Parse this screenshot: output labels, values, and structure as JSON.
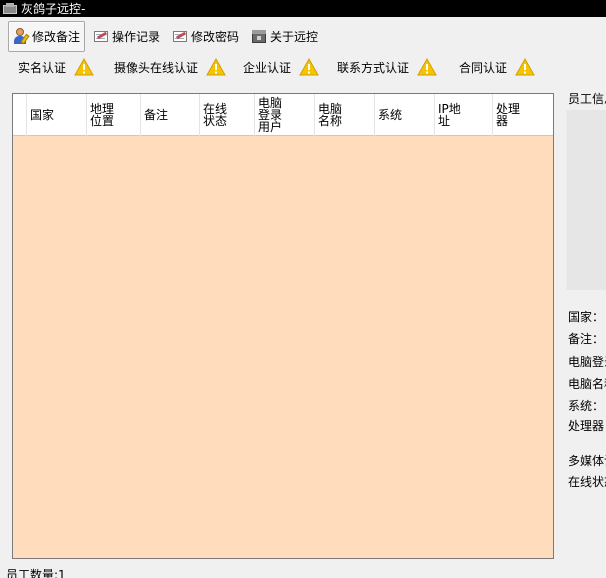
{
  "window": {
    "title": "灰鸽子远控-"
  },
  "toolbar": {
    "items": [
      {
        "label": "修改备注",
        "icon": "user-edit-icon"
      },
      {
        "label": "操作记录",
        "icon": "log-icon"
      },
      {
        "label": "修改密码",
        "icon": "password-icon"
      },
      {
        "label": "关于远控",
        "icon": "about-icon"
      }
    ]
  },
  "certifications": [
    {
      "label": "实名认证",
      "icon": "warning-icon"
    },
    {
      "label": "摄像头在线认证",
      "icon": "warning-icon"
    },
    {
      "label": "企业认证",
      "icon": "warning-icon"
    },
    {
      "label": "联系方式认证",
      "icon": "warning-icon"
    },
    {
      "label": "合同认证",
      "icon": "warning-icon"
    }
  ],
  "table": {
    "columns": [
      "国家",
      "地理\n位置",
      "备注",
      "在线\n状态",
      "电脑\n登录\n用户",
      "电脑\n名称",
      "系统",
      "IP地\n址",
      "处理\n器"
    ],
    "rows": []
  },
  "side_panel": {
    "title": "员工信息",
    "fields": [
      "国家：",
      "备注：",
      "电脑登录用户：",
      "电脑名称：",
      "系统：",
      "处理器："
    ],
    "extra": [
      "多媒体设备：",
      "在线状态："
    ]
  },
  "status": {
    "employee_count": "员工数量:1"
  },
  "colors": {
    "table_bg": "#ffdcbc",
    "warning": "#f5c400",
    "titlebar": "#000000"
  }
}
